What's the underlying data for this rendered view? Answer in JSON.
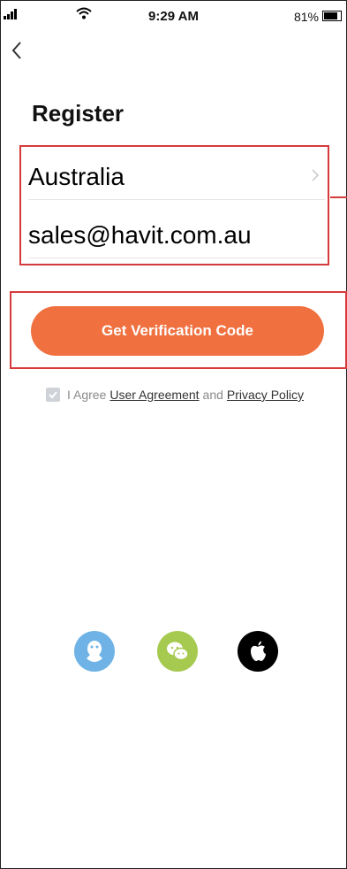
{
  "status_bar": {
    "time": "9:29 AM",
    "battery_percent": "81%",
    "battery_level": 0.81
  },
  "nav": {
    "back_icon": "chevron-left-icon"
  },
  "page": {
    "title": "Register"
  },
  "form": {
    "country": "Australia",
    "email": "sales@havit.com.au"
  },
  "actions": {
    "get_code_label": "Get Verification Code"
  },
  "agreement": {
    "prefix": "I Agree",
    "user_agreement": "User Agreement",
    "conjunction": "and",
    "privacy_policy": "Privacy Policy",
    "checked": true
  },
  "social_login": [
    {
      "icon": "qq-icon",
      "color": "#6fb3e6"
    },
    {
      "icon": "wechat-icon",
      "color": "#a6c94f"
    },
    {
      "icon": "apple-icon",
      "color": "#000000"
    }
  ],
  "colors": {
    "accent": "#f0703f",
    "annotation": "#d63a3a"
  }
}
